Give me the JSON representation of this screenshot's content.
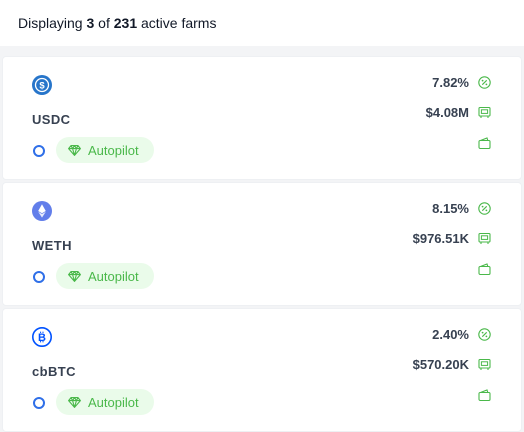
{
  "header": {
    "prefix": "Displaying",
    "shown": "3",
    "of": "of",
    "total": "231",
    "suffix": "active farms"
  },
  "colors": {
    "accent_green": "#4ab84a",
    "ring_blue": "#2f6fe8",
    "usdc_blue": "#2775ca",
    "weth_purple": "#627eea",
    "cbbtc_blue": "#0052ff"
  },
  "farms": [
    {
      "token": "USDC",
      "icon": "usdc-icon",
      "apr": "7.82%",
      "tvl": "$4.08M",
      "badge": "Autopilot"
    },
    {
      "token": "WETH",
      "icon": "weth-icon",
      "apr": "8.15%",
      "tvl": "$976.51K",
      "badge": "Autopilot"
    },
    {
      "token": "cbBTC",
      "icon": "cbbtc-icon",
      "apr": "2.40%",
      "tvl": "$570.20K",
      "badge": "Autopilot"
    }
  ]
}
